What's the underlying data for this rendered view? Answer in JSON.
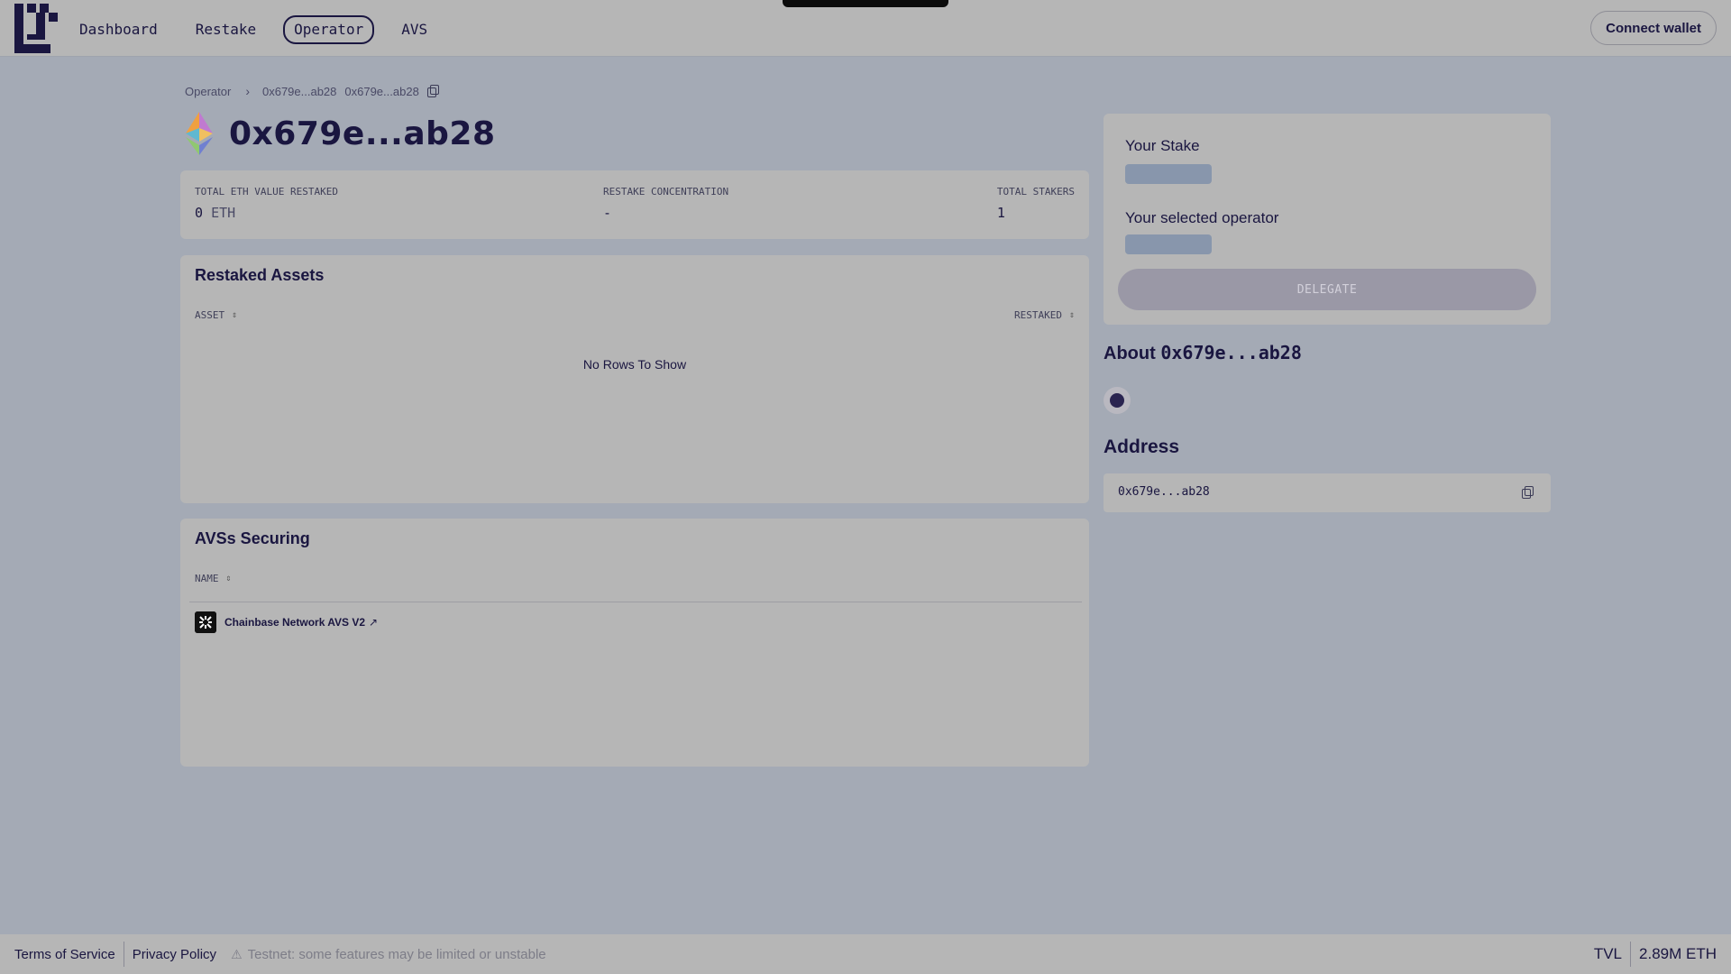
{
  "nav": {
    "items": [
      {
        "label": "Dashboard",
        "active": false
      },
      {
        "label": "Restake",
        "active": false
      },
      {
        "label": "Operator",
        "active": true
      },
      {
        "label": "AVS",
        "active": false
      }
    ],
    "connect_label": "Connect wallet"
  },
  "breadcrumb": {
    "root": "Operator",
    "current": "0x679e...ab28",
    "address": "0x679e...ab28"
  },
  "page_title": "0x679e...ab28",
  "stats": {
    "total_eth_label": "TOTAL ETH VALUE RESTAKED",
    "total_eth_value": "0",
    "total_eth_unit": "ETH",
    "concentration_label": "RESTAKE CONCENTRATION",
    "concentration_value": "-",
    "stakers_label": "TOTAL STAKERS",
    "stakers_value": "1"
  },
  "restaked_assets": {
    "title": "Restaked Assets",
    "col_asset": "ASSET",
    "col_restaked": "RESTAKED",
    "empty_text": "No Rows To Show"
  },
  "avs_securing": {
    "title": "AVSs Securing",
    "col_name": "NAME",
    "rows": [
      {
        "name": "Chainbase Network AVS V2"
      }
    ]
  },
  "stake_panel": {
    "your_stake_label": "Your Stake",
    "selected_operator_label": "Your selected operator",
    "delegate_label": "DELEGATE"
  },
  "about": {
    "prefix": "About",
    "address": "0x679e...ab28"
  },
  "address_section": {
    "title": "Address",
    "value": "0x679e...ab28"
  },
  "footer": {
    "terms": "Terms of Service",
    "privacy": "Privacy Policy",
    "testnet_notice": "Testnet: some features may be limited or unstable",
    "tvl_label": "TVL",
    "tvl_value": "2.89M ETH"
  },
  "icons": {
    "logo": "eigenlayer-logo",
    "eth": "ethereum-icon",
    "copy": "copy-icon",
    "sort": "sort-icon",
    "external": "external-link-icon",
    "warning": "warning-icon"
  },
  "colors": {
    "background": "#a4aab5",
    "surface": "#b6b6b6",
    "text": "#1a1640",
    "skeleton": "#8896ac",
    "button_disabled": "#9a98a6"
  }
}
